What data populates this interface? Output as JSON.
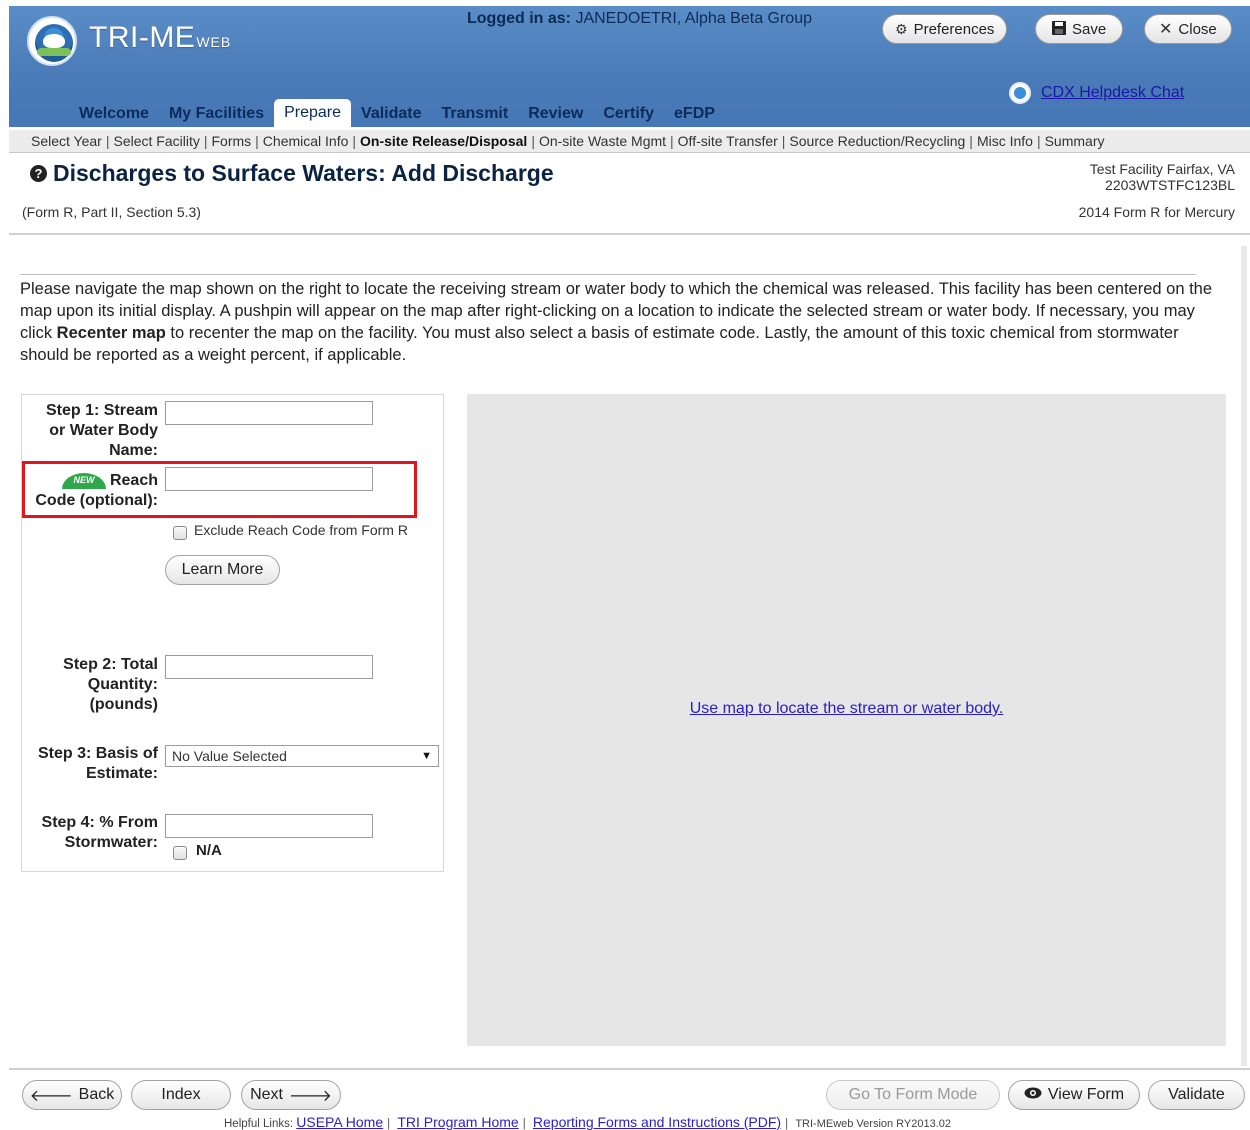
{
  "app": {
    "title_main": "TRI-ME",
    "title_sub": "WEB",
    "logged_in_label": "Logged in as:",
    "logged_in_user": "JANEDOETRI, Alpha Beta Group"
  },
  "header_buttons": {
    "preferences": "Preferences",
    "save": "Save",
    "close": "Close"
  },
  "helpdesk": {
    "label": "CDX Helpdesk Chat"
  },
  "tabs": [
    {
      "label": "Welcome",
      "active": false
    },
    {
      "label": "My Facilities",
      "active": false
    },
    {
      "label": "Prepare",
      "active": true
    },
    {
      "label": "Validate",
      "active": false
    },
    {
      "label": "Transmit",
      "active": false
    },
    {
      "label": "Review",
      "active": false
    },
    {
      "label": "Certify",
      "active": false
    },
    {
      "label": "eFDP",
      "active": false
    }
  ],
  "subnav": [
    {
      "label": "Select Year",
      "active": false
    },
    {
      "label": "Select Facility",
      "active": false
    },
    {
      "label": "Forms",
      "active": false
    },
    {
      "label": "Chemical Info",
      "active": false
    },
    {
      "label": "On-site Release/Disposal",
      "active": true
    },
    {
      "label": "On-site Waste Mgmt",
      "active": false
    },
    {
      "label": "Off-site Transfer",
      "active": false
    },
    {
      "label": "Source Reduction/Recycling",
      "active": false
    },
    {
      "label": "Misc Info",
      "active": false
    },
    {
      "label": "Summary",
      "active": false
    }
  ],
  "page": {
    "title": "Discharges to Surface Waters: Add Discharge",
    "form_ref": "(Form R, Part II, Section 5.3)",
    "facility_name": "Test Facility Fairfax, VA",
    "facility_id": "2203WTSTFC123BL",
    "form_for": "2014 Form R for Mercury"
  },
  "instructions": {
    "part1": "Please navigate the map shown on the right to locate the receiving stream or water body to which the chemical was released. This facility has been centered on the map upon its initial display. A pushpin will appear on the map after right-clicking on a location to indicate the selected stream or water body. If necessary, you may click ",
    "bold": "Recenter map",
    "part2": " to recenter the map on the facility. You must also select a basis of estimate code. Lastly, the amount of this toxic chemical from stormwater should be reported as a weight percent, if applicable."
  },
  "form": {
    "step1_label_l1": "Step 1: Stream",
    "step1_label_l2": "or Water Body",
    "step1_label_l3": "Name:",
    "step1_value": "",
    "new_badge": "NEW",
    "reach_label_l1": "Reach",
    "reach_label_l2": "Code (optional):",
    "reach_value": "",
    "exclude_label": "Exclude Reach Code from Form R",
    "learn_more": "Learn More",
    "step2_label_l1": "Step 2: Total",
    "step2_label_l2": "Quantity:",
    "step2_label_l3": "(pounds)",
    "step2_value": "",
    "step3_label_l1": "Step 3: Basis of",
    "step3_label_l2": "Estimate:",
    "step3_selected": "No Value Selected",
    "step4_label_l1": "Step 4: % From",
    "step4_label_l2": "Stormwater:",
    "step4_value": "",
    "na_label": "N/A"
  },
  "map": {
    "link": "Use map to locate the stream or water body."
  },
  "footer_buttons": {
    "back": "Back",
    "index": "Index",
    "next": "Next",
    "go_to_form_mode": "Go To Form Mode",
    "view_form": "View Form",
    "validate": "Validate"
  },
  "helpful_links": {
    "label": "Helpful Links:",
    "usepa": "USEPA Home",
    "tri": "TRI Program Home",
    "forms": "Reporting Forms and Instructions (PDF)",
    "version": "TRI-MEweb Version RY2013.02"
  },
  "colors": {
    "header_blue": "#4a7ab7",
    "highlight_red": "#e0161c",
    "link_blue": "#2a1ec7"
  }
}
